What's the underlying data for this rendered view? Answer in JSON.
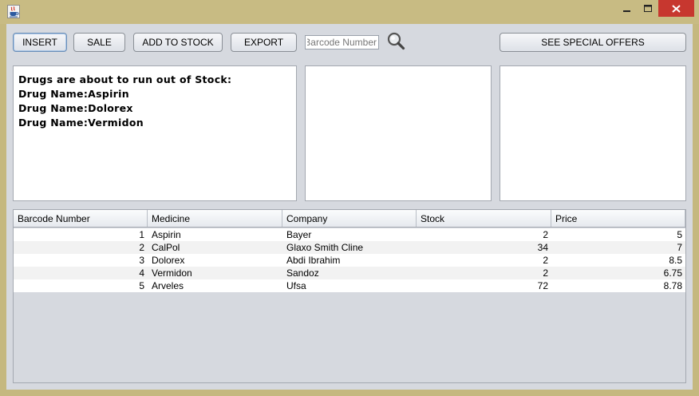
{
  "window": {
    "app_icon": "java-coffee-cup-icon",
    "controls": [
      "minimize-icon",
      "maximize-icon",
      "close-icon"
    ]
  },
  "toolbar": {
    "insert_label": "INSERT",
    "sale_label": "SALE",
    "add_to_stock_label": "ADD TO STOCK",
    "export_label": "EXPORT",
    "search_placeholder": "Barcode Number",
    "search_icon": "magnifier-icon",
    "special_offers_label": "SEE SPECIAL OFFERS"
  },
  "alert_panel": {
    "lines": [
      "Drugs are about to run out of Stock:",
      "Drug Name:Aspirin",
      "Drug Name:Dolorex",
      "Drug Name:Vermidon"
    ]
  },
  "table": {
    "columns": [
      "Barcode Number",
      "Medicine",
      "Company",
      "Stock",
      "Price"
    ],
    "rows": [
      [
        "1",
        "Aspirin",
        "Bayer",
        "2",
        "5"
      ],
      [
        "2",
        "CalPol",
        "Glaxo Smith Cline",
        "34",
        "7"
      ],
      [
        "3",
        "Dolorex",
        "Abdi Ibrahim",
        "2",
        "8.5"
      ],
      [
        "4",
        "Vermidon",
        "Sandoz",
        "2",
        "6.75"
      ],
      [
        "5",
        "Arveles",
        "Ufsa",
        "72",
        "8.78"
      ]
    ]
  },
  "colors": {
    "window_frame": "#c8bb83",
    "close_button": "#c7372f",
    "client_bg": "#d6d9df",
    "focused_button_border": "#6b8fb8"
  }
}
